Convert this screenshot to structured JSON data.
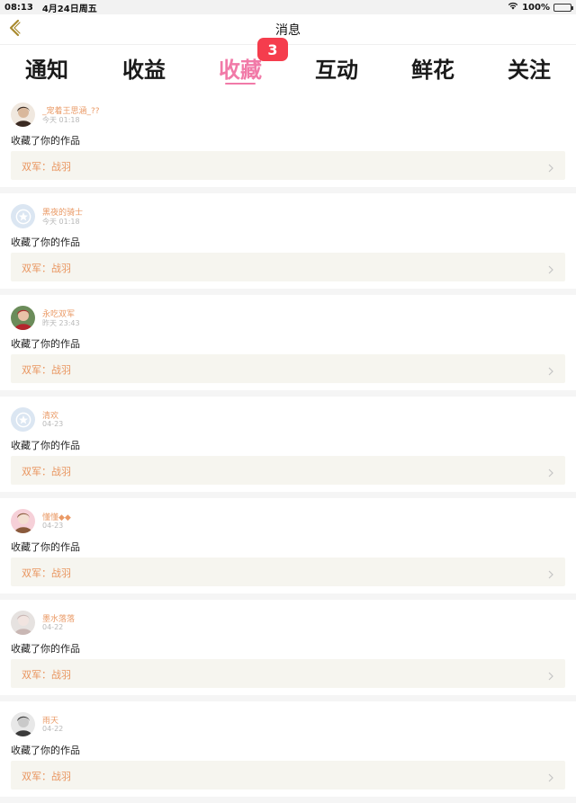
{
  "status_bar": {
    "time": "08:13",
    "date": "4月24日周五",
    "battery": "100%",
    "battery_level": 1.0
  },
  "nav": {
    "title": "消息"
  },
  "tabs": [
    {
      "label": "通知",
      "active": false
    },
    {
      "label": "收益",
      "active": false
    },
    {
      "label": "收藏",
      "active": true
    },
    {
      "label": "互动",
      "active": false
    },
    {
      "label": "鲜花",
      "active": false
    },
    {
      "label": "关注",
      "active": false
    }
  ],
  "badge": "3",
  "colors": {
    "accent": "#f17aa8",
    "badge": "#f53d4d",
    "username": "#ea9a66",
    "work_title": "#e9955f",
    "work_bg": "#f6f5ef"
  },
  "feed": [
    {
      "username": "_宠着王思涵_??",
      "time": "今天 01:18",
      "action": "收藏了你的作品",
      "work": "双军：战羽",
      "avatar": "photo-dark"
    },
    {
      "username": "黑夜的骑士",
      "time": "今天 01:18",
      "action": "收藏了你的作品",
      "work": "双军：战羽",
      "avatar": "default"
    },
    {
      "username": "永吃双军",
      "time": "昨天 23:43",
      "action": "收藏了你的作品",
      "work": "双军：战羽",
      "avatar": "photo-red"
    },
    {
      "username": "清欢",
      "time": "04-23",
      "action": "收藏了你的作品",
      "work": "双军：战羽",
      "avatar": "default"
    },
    {
      "username": "懂懂◆◆",
      "time": "04-23",
      "action": "收藏了你的作品",
      "work": "双军：战羽",
      "avatar": "photo-pink"
    },
    {
      "username": "墨水落落",
      "time": "04-22",
      "action": "收藏了你的作品",
      "work": "双军：战羽",
      "avatar": "photo-grey"
    },
    {
      "username": "雨天",
      "time": "04-22",
      "action": "收藏了你的作品",
      "work": "双军：战羽",
      "avatar": "photo-bw"
    }
  ]
}
